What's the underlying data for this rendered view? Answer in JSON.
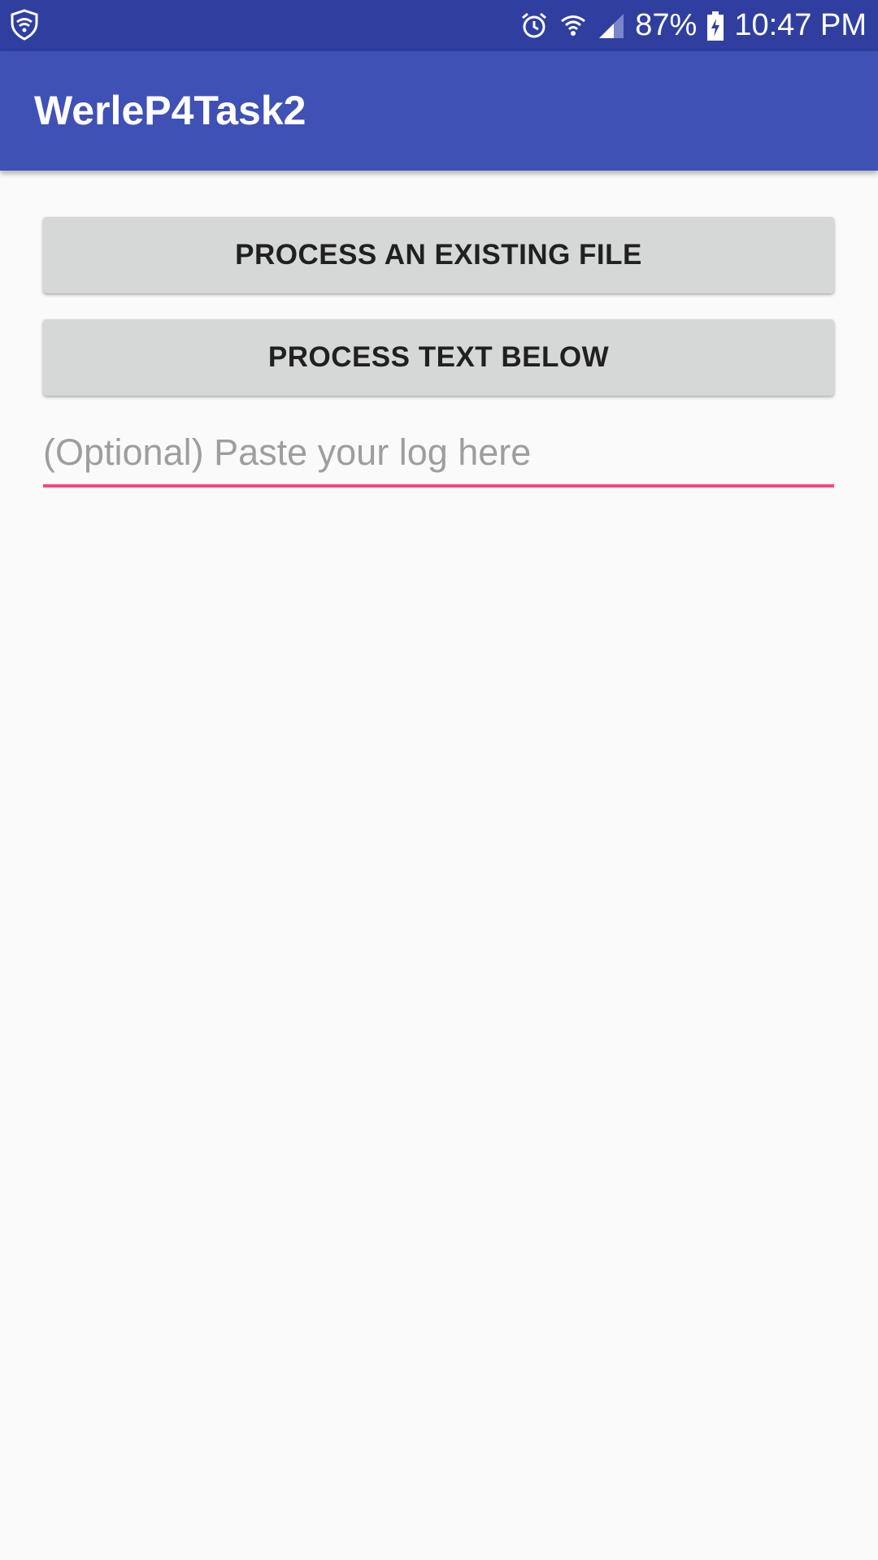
{
  "status_bar": {
    "battery_percent": "87%",
    "time": "10:47 PM",
    "icons": [
      "shield-icon",
      "alarm-icon",
      "wifi-icon",
      "signal-icon",
      "battery-charging-icon"
    ],
    "background_color": "#303f9f"
  },
  "app_bar": {
    "title": "WerleP4Task2",
    "background_color": "#3f51b5"
  },
  "main": {
    "process_file_button": "PROCESS AN EXISTING FILE",
    "process_text_button": "PROCESS TEXT BELOW",
    "log_input": {
      "value": "",
      "placeholder": "(Optional) Paste your log here",
      "accent_color": "#ff4081"
    }
  }
}
